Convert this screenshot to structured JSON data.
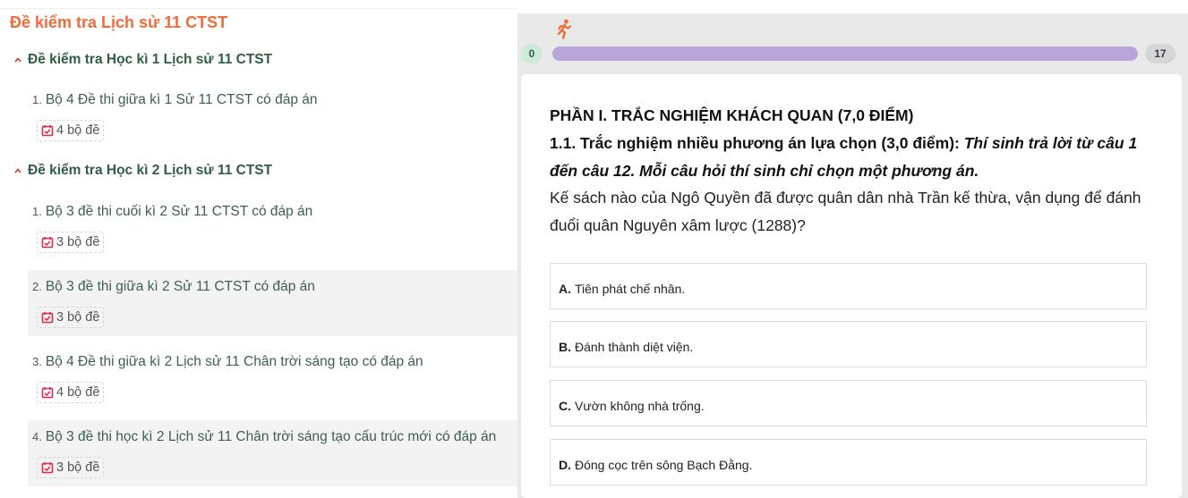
{
  "sidebar": {
    "title": "Đề kiểm tra Lịch sử 11 CTST",
    "sections": [
      {
        "title": "Đề kiểm tra Học kì 1 Lịch sử 11 CTST",
        "items": [
          {
            "num": "1.",
            "title": "Bộ 4 Đề thi giữa kì 1 Sử 11 CTST có đáp án",
            "badge": "4 bộ đề"
          }
        ]
      },
      {
        "title": "Đề kiểm tra Học kì 2 Lịch sử 11 CTST",
        "items": [
          {
            "num": "1.",
            "title": "Bộ 3 đề thi cuối kì 2 Sử 11 CTST có đáp án",
            "badge": "3 bộ đề"
          },
          {
            "num": "2.",
            "title": "Bộ 3 đề thi giữa kì 2 Sử 11 CTST có đáp án",
            "badge": "3 bộ đề"
          },
          {
            "num": "3.",
            "title": "Bộ 4 Đề thi giữa kì 2 Lịch sử 11 Chân trời sáng tạo có đáp án",
            "badge": "4 bộ đề"
          },
          {
            "num": "4.",
            "title": "Bộ 3 đề thi học kì 2 Lịch sử 11 Chân trời sáng tạo cấu trúc mới có đáp án",
            "badge": "3 bộ đề"
          }
        ]
      }
    ]
  },
  "quiz": {
    "runner_icon": "running-person-icon",
    "progress": {
      "start": "0",
      "end": "17",
      "fraction": 0
    },
    "part_title": "PHẦN I. TRẮC NGHIỆM KHÁCH QUAN (7,0 ĐIỂM)",
    "sub_label": "1.1. Trắc nghiệm nhiều phương án lựa chọn (3,0 điểm):",
    "instruction": "Thí sinh trả lời từ câu 1 đến câu 12. Mỗi câu hỏi thí sinh chỉ chọn một phương án.",
    "question": "Kế sách nào của Ngô Quyền đã được quân dân nhà Trần kế thừa, vận dụng để đánh đuổi quân Nguyên xâm lược (1288)?",
    "options": [
      {
        "key": "A.",
        "text": "Tiên phát chế nhân."
      },
      {
        "key": "B.",
        "text": "Đánh thành diệt viện."
      },
      {
        "key": "C.",
        "text": "Vườn không nhà trống."
      },
      {
        "key": "D.",
        "text": "Đóng cọc trên sông Bạch Đằng."
      }
    ]
  },
  "colors": {
    "title_orange": "#f26b38",
    "section_green": "#2f5d46",
    "calendar_red": "#e8284b",
    "progress_track": "#b9a5d8"
  }
}
